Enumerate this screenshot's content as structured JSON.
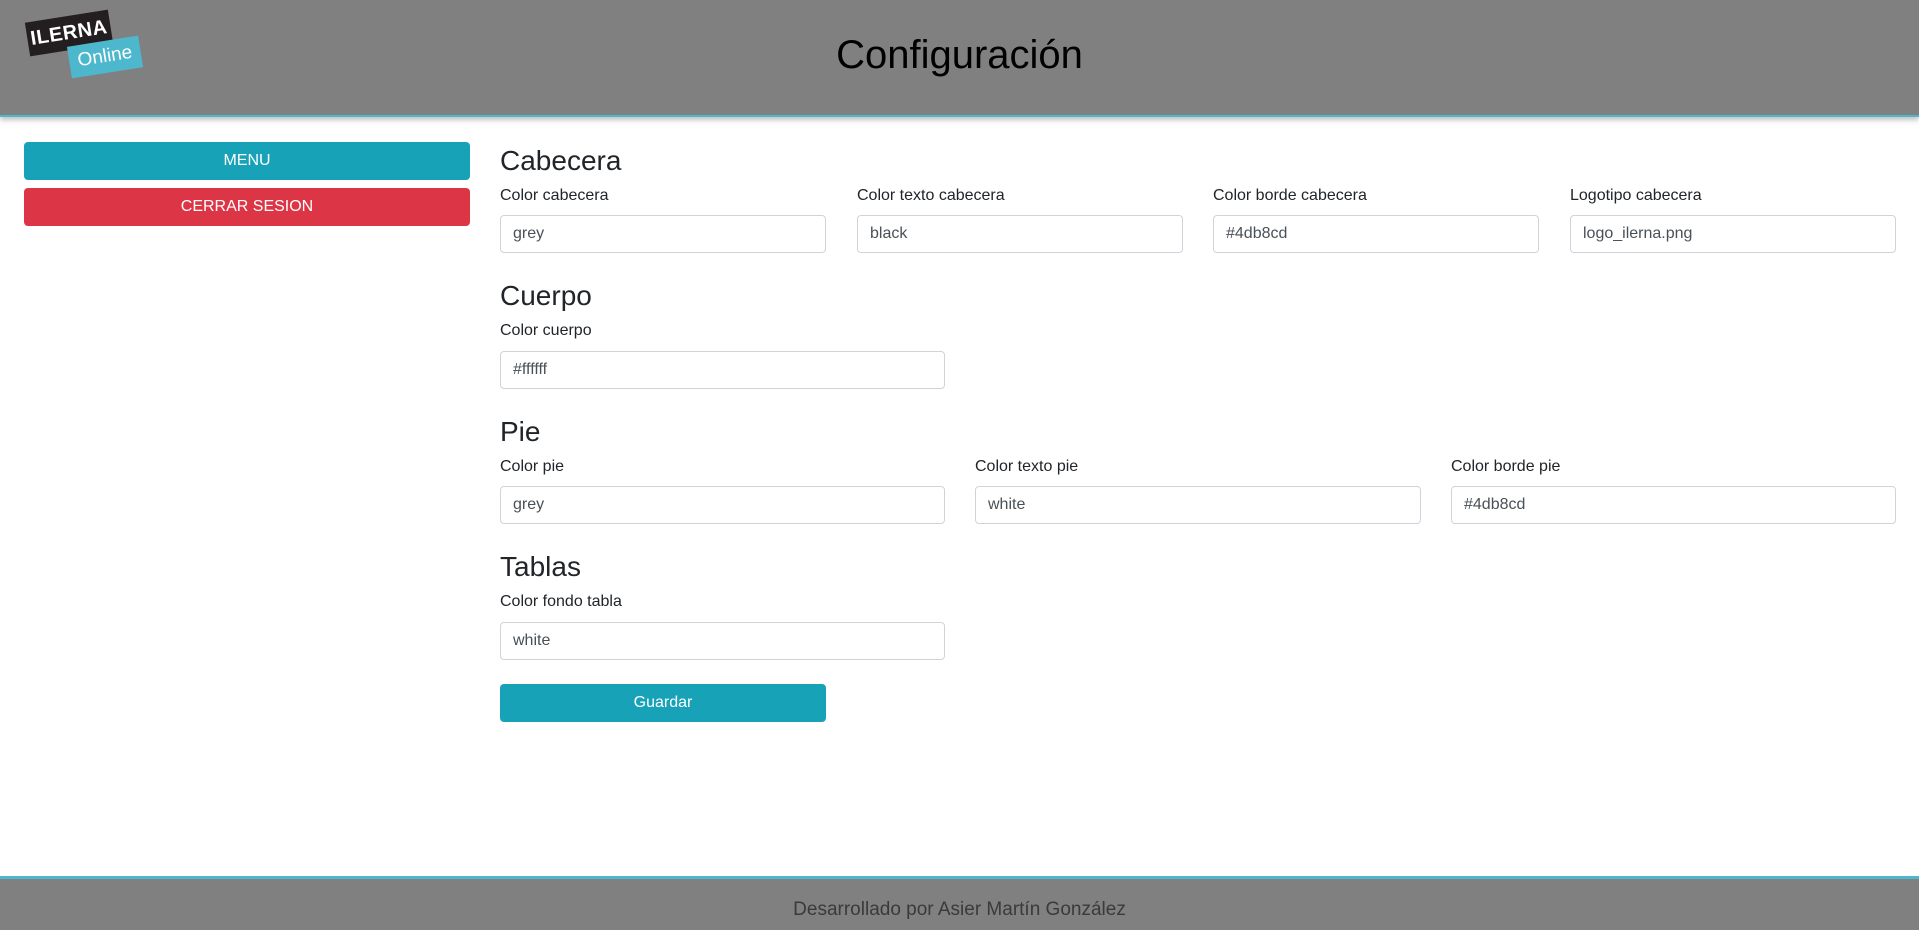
{
  "header": {
    "title": "Configuración",
    "logo": {
      "line1": "ILERNA",
      "line2": "Online"
    }
  },
  "sidebar": {
    "menu_label": "MENU",
    "logout_label": "CERRAR SESION"
  },
  "sections": {
    "cabecera": {
      "title": "Cabecera",
      "fields": [
        {
          "label": "Color cabecera",
          "value": "grey"
        },
        {
          "label": "Color texto cabecera",
          "value": "black"
        },
        {
          "label": "Color borde cabecera",
          "value": "#4db8cd"
        },
        {
          "label": "Logotipo cabecera",
          "value": "logo_ilerna.png"
        }
      ]
    },
    "cuerpo": {
      "title": "Cuerpo",
      "fields": [
        {
          "label": "Color cuerpo",
          "value": "#ffffff"
        }
      ]
    },
    "pie": {
      "title": "Pie",
      "fields": [
        {
          "label": "Color pie",
          "value": "grey"
        },
        {
          "label": "Color texto pie",
          "value": "white"
        },
        {
          "label": "Color borde pie",
          "value": "#4db8cd"
        }
      ]
    },
    "tablas": {
      "title": "Tablas",
      "fields": [
        {
          "label": "Color fondo tabla",
          "value": "white"
        }
      ]
    }
  },
  "actions": {
    "save_label": "Guardar"
  },
  "footer": {
    "text": "Desarrollado por Asier Martín González"
  },
  "colors": {
    "header_bg": "#808080",
    "accent_border": "#4db8cd",
    "primary_button": "#17a2b8",
    "danger_button": "#dc3545"
  }
}
